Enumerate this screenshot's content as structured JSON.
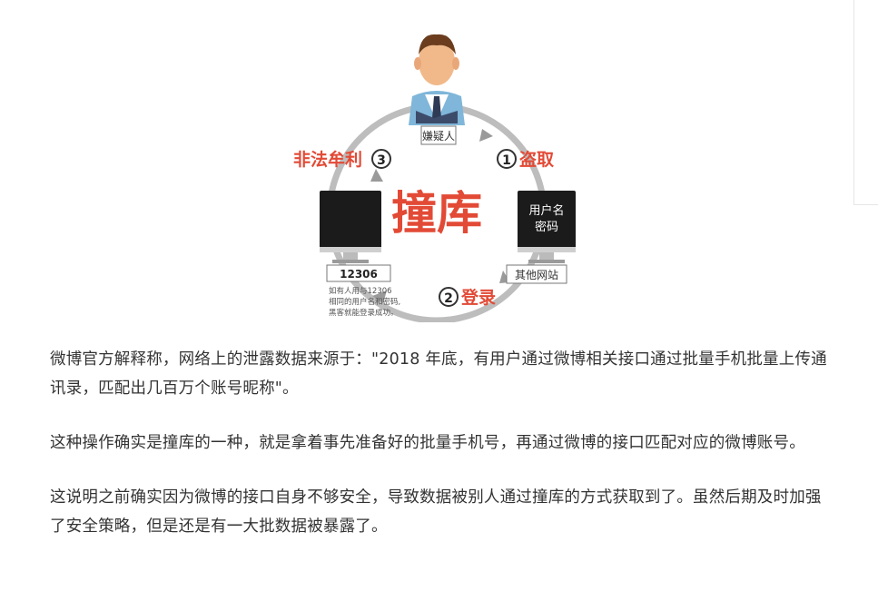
{
  "figure": {
    "center": "撞库",
    "suspect": "嫌疑人",
    "step1": "盗取",
    "step2": "登录",
    "step3": "非法牟利",
    "n1": "1",
    "n2": "2",
    "n3": "3",
    "cred_line1": "用户名",
    "cred_line2": "密码",
    "other_sites": "其他网站",
    "target_site": "12306",
    "note_line1": "如有人用与12306",
    "note_line2": "相同的用户名和密码,",
    "note_line3": "黑客就能登录成功。"
  },
  "article": {
    "paragraphs": [
      "微博官方解释称，网络上的泄露数据来源于：\"2018 年底，有用户通过微博相关接口通过批量手机批量上传通讯录，匹配出几百万个账号昵称\"。",
      "这种操作确实是撞库的一种，就是拿着事先准备好的批量手机号，再通过微博的接口匹配对应的微博账号。",
      "这说明之前确实因为微博的接口自身不够安全，导致数据被别人通过撞库的方式获取到了。虽然后期及时加强了安全策略，但是还是有一大批数据被暴露了。"
    ]
  },
  "colors": {
    "accent_red": "#e24a36",
    "text": "#333333",
    "circle_gray": "#b9b9b9"
  }
}
